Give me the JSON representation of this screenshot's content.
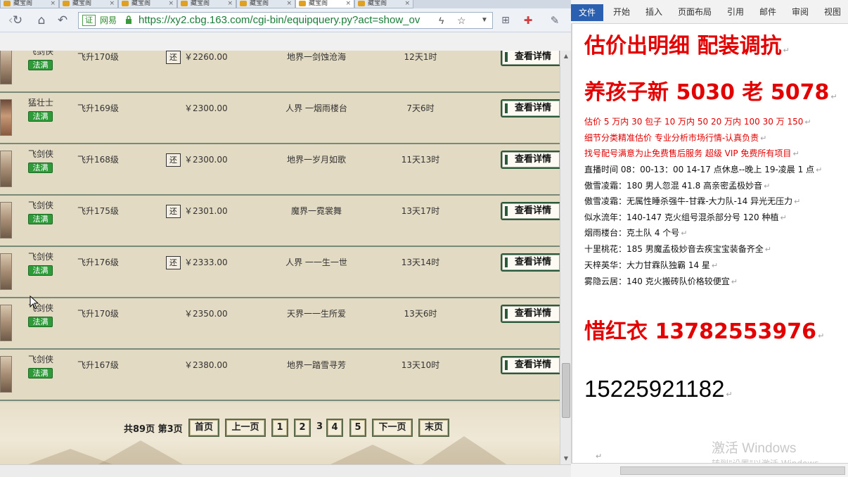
{
  "browser": {
    "tabs": [
      "藏宝阁",
      "藏宝阁",
      "藏宝阁",
      "藏宝阁",
      "藏宝阁",
      "藏宝阁",
      "藏宝阁"
    ],
    "url": {
      "cert": "证",
      "site": "网易",
      "text": "https://xy2.cbg.163.com/cgi-bin/equipquery.py?act=show_ov"
    },
    "rows": [
      {
        "name": "飞剑侠",
        "badge": "法满",
        "level": "飞升170级",
        "huan": "还",
        "price": "￥2260.00",
        "server": "地界一剑蚀沧海",
        "time": "12天1时",
        "button": "查看详情"
      },
      {
        "name": "猛壮士",
        "badge": "法满",
        "level": "飞升169级",
        "huan": "",
        "price": "￥2300.00",
        "server": "人界  一烟雨楼台",
        "time": "7天6时",
        "button": "查看详情"
      },
      {
        "name": "飞剑侠",
        "badge": "法满",
        "level": "飞升168级",
        "huan": "还",
        "price": "￥2300.00",
        "server": "地界一岁月如歌",
        "time": "11天13时",
        "button": "查看详情"
      },
      {
        "name": "飞剑侠",
        "badge": "法满",
        "level": "飞升175级",
        "huan": "还",
        "price": "￥2301.00",
        "server": "魔界一霓裳舞",
        "time": "13天17时",
        "button": "查看详情"
      },
      {
        "name": "飞剑侠",
        "badge": "法满",
        "level": "飞升176级",
        "huan": "还",
        "price": "￥2333.00",
        "server": "人界  一一生一世",
        "time": "13天14时",
        "button": "查看详情"
      },
      {
        "name": "飞剑侠",
        "badge": "法满",
        "level": "飞升170级",
        "huan": "",
        "price": "￥2350.00",
        "server": "天界一一生所爱",
        "time": "13天6时",
        "button": "查看详情"
      },
      {
        "name": "飞剑侠",
        "badge": "法满",
        "level": "飞升167级",
        "huan": "",
        "price": "￥2380.00",
        "server": "地界一踏雪寻芳",
        "time": "13天10时",
        "button": "查看详情"
      }
    ],
    "pager": {
      "total": "共89页 第3页",
      "first": "首页",
      "prev": "上一页",
      "pages": [
        "1",
        "2",
        "3",
        "4",
        "5"
      ],
      "current": "3",
      "next": "下一页",
      "last": "末页"
    }
  },
  "word": {
    "ribbon_tabs": [
      "文件",
      "开始",
      "插入",
      "页面布局",
      "引用",
      "邮件",
      "审阅",
      "视图"
    ],
    "heading1": "估价出明细 配装调抗",
    "heading2": "养孩子新 5030 老 5078",
    "red_lines": [
      "估价 5 万内 30 包子   10 万内 50  20 万内 100  30 万 150",
      "细节分类精准估价   专业分析市场行情-认真负责",
      "找号配号满意为止免费售后服务    超级 VIP 免费所有项目"
    ],
    "black_lines": [
      "直播时间 08：00-13：00 14-17 点休息--晚上 19-凌晨 1 点",
      "傲雪凌霜：180 男人忽混 41.8 高亲密孟极妙音",
      "傲雪凌霜：无属性睡杀强牛-甘霖-大力队-14 异光无压力",
      "似水流年：140-147 克火组号混杀部分号 120 种植",
      "烟雨楼台：克土队 4 个号",
      "十里桃花：185 男魔孟极妙音去疾宝宝装备齐全",
      "天梓英华：大力甘霖队独霸 14 星",
      "雾隐云居：140 克火搬砖队价格较便宜"
    ],
    "contact_name_line": "惜红衣 13782553976",
    "phone2": "15225921182",
    "watermark": "激活 Windows",
    "watermark_sub": "转到\"设置\"以激活 Windows。"
  },
  "colors": {
    "accent_red": "#e30000",
    "badge_green": "#2f9a3a",
    "url_green": "#1a7d3a",
    "word_file_blue": "#2b5faf"
  }
}
